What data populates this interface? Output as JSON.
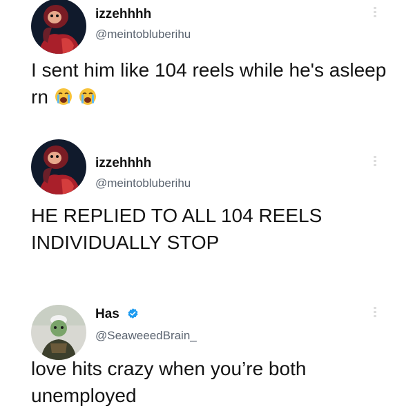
{
  "tweets": [
    {
      "name": "izzehhhh",
      "handle": "@meintobluberihu",
      "text": "I sent him like 104 reels while he's asleep rn",
      "emojis": [
        "loudly-crying-face-icon",
        "loudly-crying-face-icon"
      ]
    },
    {
      "name": "izzehhhh",
      "handle": "@meintobluberihu",
      "text_line1": "HE REPLIED TO ALL 104 REELS",
      "text_line2": "INDIVIDUALLY STOP"
    },
    {
      "name": "Has",
      "handle": "@SeaweeedBrain_",
      "verified": true,
      "text_line1": "love hits crazy when you’re both",
      "text_line2": "unemployed"
    }
  ],
  "colors": {
    "verified_blue": "#1d9bf0",
    "handle_gray": "#5b6470",
    "text": "#141414"
  }
}
